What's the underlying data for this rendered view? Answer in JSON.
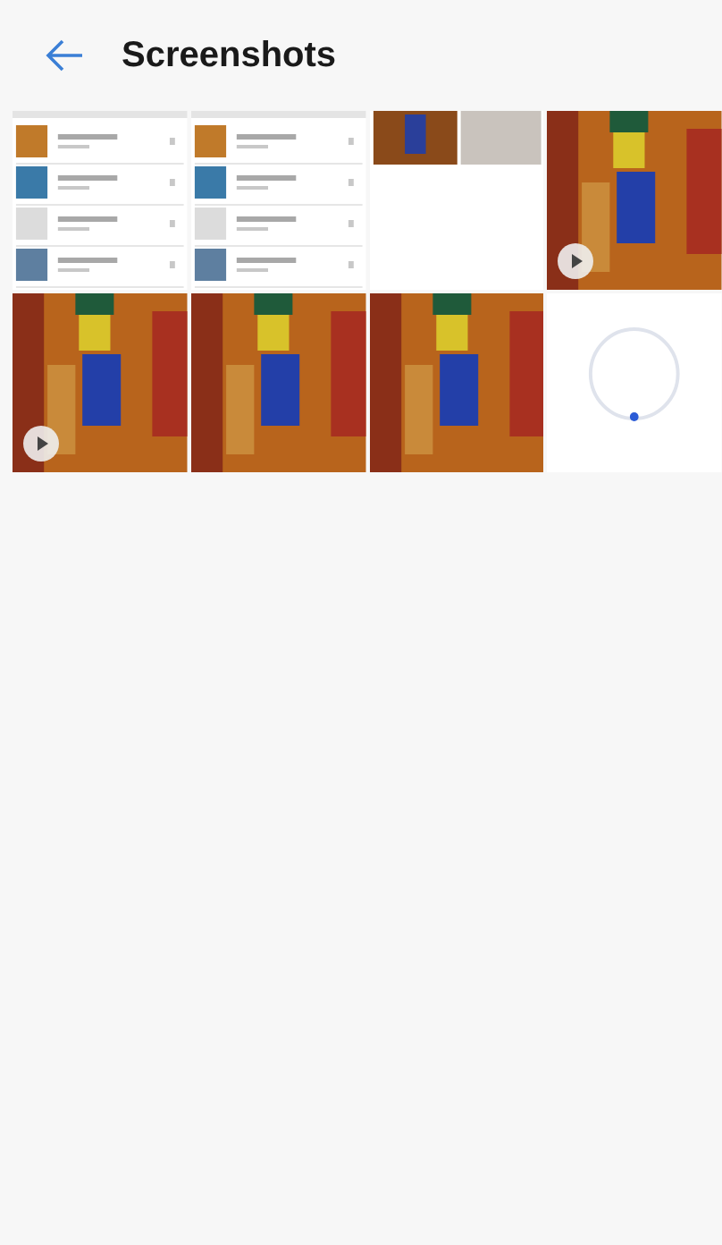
{
  "header": {
    "title": "Screenshots"
  },
  "thumbnails": [
    {
      "kind": "picture",
      "video": false
    },
    {
      "kind": "picture",
      "video": false
    },
    {
      "kind": "picture",
      "video": false
    },
    {
      "kind": "picture",
      "video": true
    },
    {
      "kind": "picture",
      "video": true
    },
    {
      "kind": "picture",
      "video": false
    },
    {
      "kind": "picture",
      "video": false
    },
    {
      "kind": "picture",
      "video": false
    }
  ]
}
